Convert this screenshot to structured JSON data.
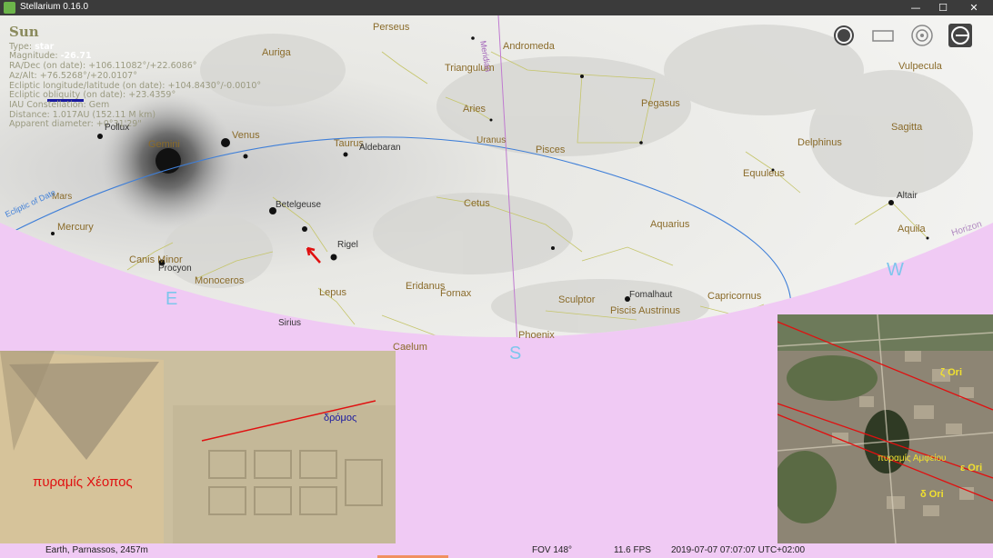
{
  "window": {
    "title": "Stellarium 0.16.0",
    "minimize": "—",
    "maximize": "☐",
    "close": "✕"
  },
  "info": {
    "name": "Sun",
    "type_label": "Type:",
    "type_value": "star",
    "mag_label": "Magnitude:",
    "mag_value": "-26.71",
    "radec": "RA/Dec (on date):  +106.11082°/+22.6086°",
    "azalt": "Az/Alt:  +76.5268°/+20.0107°",
    "ecliptic": "Ecliptic longitude/latitude (on date): +104.8430°/-0.0010°",
    "obliquity": "Ecliptic obliquity (on date): +23.4359°",
    "constellation": "IAU Constellation: Gem",
    "distance": "Distance: 1.017AU (152.11 M km)",
    "diameter": "Apparent diameter: +0°31'29\""
  },
  "toolbar": [
    {
      "name": "daylight-view-icon"
    },
    {
      "name": "screen-frame-icon"
    },
    {
      "name": "target-icon"
    },
    {
      "name": "locate-icon"
    }
  ],
  "labels": {
    "perseus": "Perseus",
    "auriga": "Auriga",
    "andromeda": "Andromeda",
    "triangulum": "Triangulum",
    "aries": "Aries",
    "pegasus": "Pegasus",
    "vulpecula": "Vulpecula",
    "sagitta": "Sagitta",
    "delphinus": "Delphinus",
    "equuleus": "Equuleus",
    "pisces": "Pisces",
    "uranus": "Uranus",
    "taurus": "Taurus",
    "aldebaran": "Aldebaran",
    "pollux": "Pollux",
    "gemini": "Gemini",
    "venus": "Venus",
    "mars": "Mars",
    "mercury": "Mercury",
    "betelgeuse": "Betelgeuse",
    "rigel": "Rigel",
    "cetus": "Cetus",
    "aquarius": "Aquarius",
    "altair": "Altair",
    "aquila": "Aquila",
    "canis_minor": "Canis Minor",
    "procyon": "Procyon",
    "monoceros": "Monoceros",
    "lepus": "Lepus",
    "eridanus": "Eridanus",
    "fornax": "Fornax",
    "sculptor": "Sculptor",
    "fomalhaut": "Fomalhaut",
    "piscis_austrinus": "Piscis Austrinus",
    "capricornus": "Capricornus",
    "sirius": "Sirius",
    "caelum": "Caelum",
    "phoenix": "Phoenix",
    "meridian": "Meridian",
    "ecliptic": "Ecliptic of Date",
    "horizon": "Horizon"
  },
  "cardinals": {
    "east": "E",
    "south": "S",
    "west": "W"
  },
  "photo_left": {
    "pyramid": "πυραμίς Χέοπος",
    "road": "δρόμος"
  },
  "photo_right": {
    "zeta": "ζ Ori",
    "epsilon": "ε Ori",
    "delta": "δ Ori",
    "pyramid": "πυραμίς Αμφείου"
  },
  "status": {
    "location": "Earth, Parnassos, 2457m",
    "fov": "FOV 148°",
    "fps": "11.6 FPS",
    "datetime": "2019-07-07 07:07:07 UTC+02:00"
  },
  "colors": {
    "ground": "#f0caf4",
    "ecliptic": "#3f7fd8",
    "meridian": "#c07ad0",
    "cardinal": "#7ec6ec"
  }
}
